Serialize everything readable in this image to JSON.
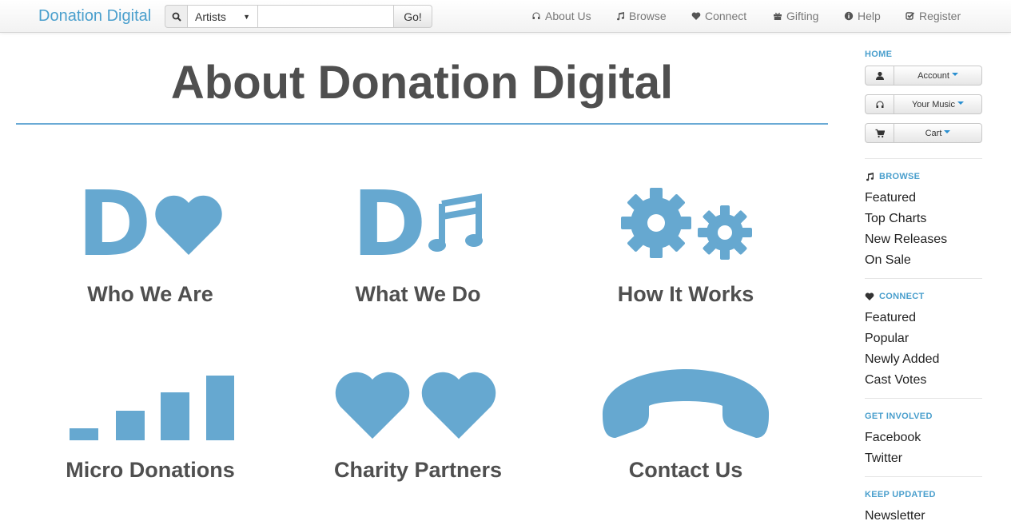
{
  "navbar": {
    "brand": "Donation Digital",
    "search": {
      "category": "Artists",
      "query": "",
      "placeholder": "",
      "go_label": "Go!"
    },
    "links": [
      {
        "label": "About Us",
        "icon": "headphones-icon"
      },
      {
        "label": "Browse",
        "icon": "music-note-icon"
      },
      {
        "label": "Connect",
        "icon": "heart-icon"
      },
      {
        "label": "Gifting",
        "icon": "gift-icon"
      },
      {
        "label": "Help",
        "icon": "info-circle-icon"
      },
      {
        "label": "Register",
        "icon": "check-square-icon"
      }
    ]
  },
  "main": {
    "title": "About Donation Digital",
    "tiles": [
      {
        "label": "Who We Are",
        "icon": "d-heart-icon"
      },
      {
        "label": "What We Do",
        "icon": "d-music-icon"
      },
      {
        "label": "How It Works",
        "icon": "gears-icon"
      },
      {
        "label": "Micro Donations",
        "icon": "signal-bars-icon"
      },
      {
        "label": "Charity Partners",
        "icon": "two-hearts-icon"
      },
      {
        "label": "Contact Us",
        "icon": "phone-icon"
      }
    ],
    "glyph_letter": "D"
  },
  "sidebar": {
    "home": {
      "heading": "HOME",
      "buttons": [
        {
          "label": "Account",
          "icon": "user-icon"
        },
        {
          "label": "Your Music",
          "icon": "headphones-icon"
        },
        {
          "label": "Cart",
          "icon": "cart-icon"
        }
      ]
    },
    "browse": {
      "heading": "BROWSE",
      "icon": "music-note-icon",
      "items": [
        "Featured",
        "Top Charts",
        "New Releases",
        "On Sale"
      ]
    },
    "connect": {
      "heading": "CONNECT",
      "icon": "heart-icon",
      "items": [
        "Featured",
        "Popular",
        "Newly Added",
        "Cast Votes"
      ]
    },
    "get_involved": {
      "heading": "GET INVOLVED",
      "items": [
        "Facebook",
        "Twitter"
      ]
    },
    "keep_updated": {
      "heading": "KEEP UPDATED",
      "items": [
        "Newsletter"
      ]
    }
  },
  "colors": {
    "brand_blue": "#4a9fcd",
    "icon_blue": "#66a8d0",
    "title_gray": "#4f4f4f",
    "caret_blue": "#2a8fd0"
  }
}
